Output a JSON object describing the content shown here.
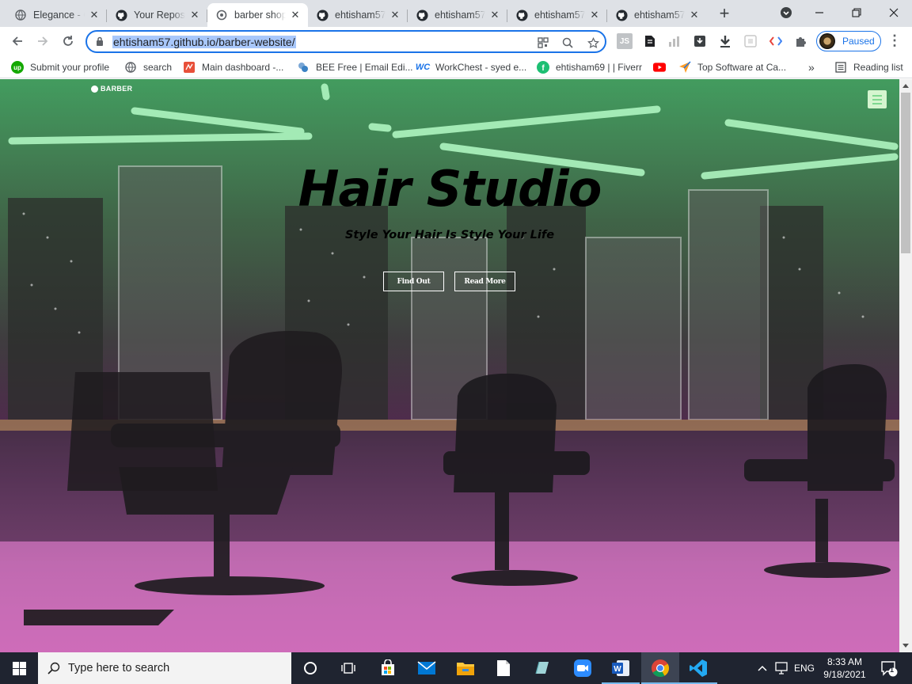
{
  "browser": {
    "tabs": [
      {
        "title": "Elegance - C",
        "icon": "web-icon",
        "active": false
      },
      {
        "title": "Your Reposi",
        "icon": "github-icon",
        "active": false
      },
      {
        "title": "barber shop",
        "icon": "loading-icon",
        "active": true
      },
      {
        "title": "ehtisham57",
        "icon": "github-icon",
        "active": false
      },
      {
        "title": "ehtisham57",
        "icon": "github-icon",
        "active": false
      },
      {
        "title": "ehtisham57",
        "icon": "github-icon",
        "active": false
      },
      {
        "title": "ehtisham57",
        "icon": "github-icon",
        "active": false
      }
    ],
    "url": "ehtisham57.github.io/barber-website/",
    "profile_status": "Paused",
    "bookmarks": [
      {
        "label": "Submit your profile",
        "icon": "upwork-icon",
        "color": "#14a800"
      },
      {
        "label": "search",
        "icon": "globe-icon",
        "color": "#5f6368"
      },
      {
        "label": "Main dashboard -...",
        "icon": "dashboard-icon",
        "color": "#e8503a"
      },
      {
        "label": "BEE Free | Email Edi...",
        "icon": "bee-icon",
        "color": "#3b82c4"
      },
      {
        "label": "WorkChest - syed e...",
        "icon": "workchest-icon",
        "color": "#1a73e8"
      },
      {
        "label": "ehtisham69 | | Fiverr",
        "icon": "fiverr-icon",
        "color": "#1dbf73"
      },
      {
        "label": "",
        "icon": "youtube-icon",
        "color": "#ff0000"
      },
      {
        "label": "Top Software at Ca...",
        "icon": "capterra-icon",
        "color": "#ff9d28"
      }
    ],
    "reading_list": "Reading list",
    "more_bookmarks": "»"
  },
  "page": {
    "brand": "BARBER",
    "title": "Hair Studio",
    "subtitle": "Style Your Hair Is Style Your Life",
    "buttons": {
      "find_out": "Find Out",
      "read_more": "Read More"
    },
    "overlay_top_color": "#3cd26e",
    "overlay_bottom_color": "#c83caa"
  },
  "taskbar": {
    "search_placeholder": "Type here to search",
    "language": "ENG",
    "time": "8:33 AM",
    "date": "9/18/2021",
    "notification_count": "1",
    "apps": [
      "cortana-icon",
      "task-view-icon",
      "store-icon",
      "mail-icon",
      "file-explorer-icon",
      "notepad-icon",
      "sticky-icon",
      "zoom-icon",
      "word-icon",
      "chrome-icon",
      "vscode-icon"
    ]
  }
}
